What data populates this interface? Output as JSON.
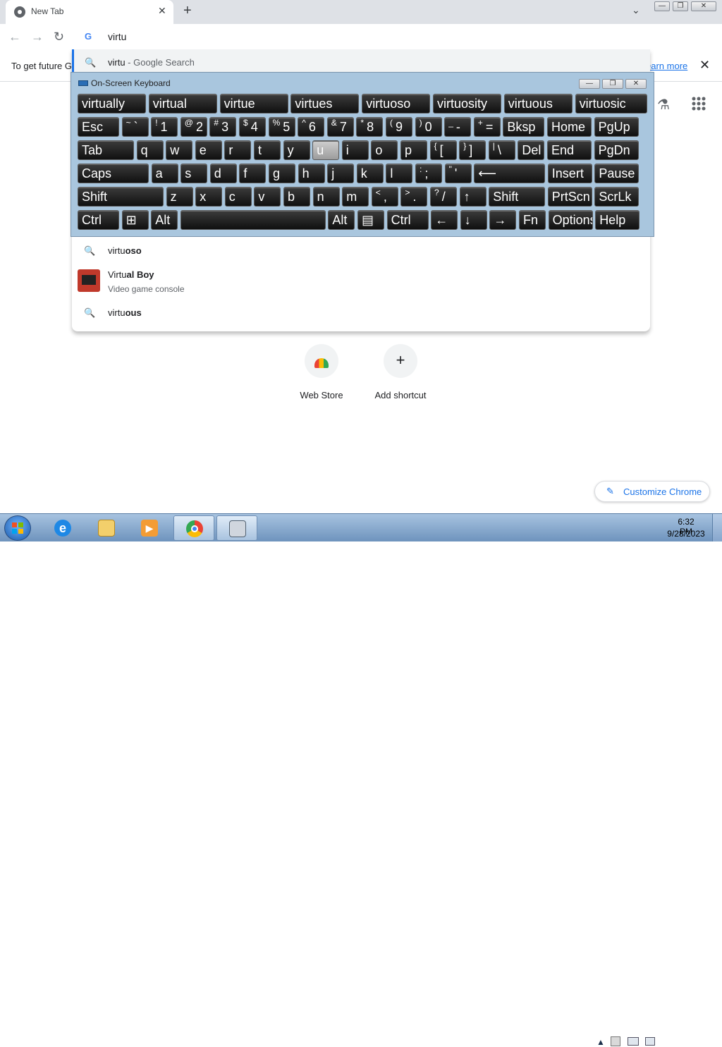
{
  "browser": {
    "tab_title": "New Tab",
    "tab_close": "✕",
    "new_tab": "+",
    "tab_search": "⌄",
    "window_min": "—",
    "window_restore": "❐",
    "window_close": "✕",
    "nav_back": "←",
    "nav_forward": "→",
    "nav_reload": "↻",
    "omnibox_value": "virtu",
    "omnibox_icon": "G",
    "info_text": "To get future G",
    "info_link": "earn more",
    "info_close": "✕",
    "kebab": "⋮"
  },
  "dropdown": {
    "first": {
      "query": "virtu",
      "suffix": " - Google Search"
    },
    "items": [
      {
        "prefix": "virtu",
        "bold": "oso",
        "sub": ""
      },
      {
        "prefix": "Virtu",
        "bold": "al Boy",
        "sub": "Video game console"
      },
      {
        "prefix": "virtu",
        "bold": "ous",
        "sub": ""
      }
    ],
    "search_icon": "🔍"
  },
  "osk": {
    "title": "On-Screen Keyboard",
    "title_min": "—",
    "title_restore": "❐",
    "title_close": "✕",
    "predictions": [
      "virtually",
      "virtual",
      "virtue",
      "virtues",
      "virtuoso",
      "virtuosity",
      "virtuous",
      "virtuosic"
    ],
    "row1": [
      {
        "label": "Esc"
      },
      {
        "sup": "~",
        "main": "`"
      },
      {
        "sup": "!",
        "main": "1"
      },
      {
        "sup": "@",
        "main": "2"
      },
      {
        "sup": "#",
        "main": "3"
      },
      {
        "sup": "$",
        "main": "4"
      },
      {
        "sup": "%",
        "main": "5"
      },
      {
        "sup": "^",
        "main": "6"
      },
      {
        "sup": "&",
        "main": "7"
      },
      {
        "sup": "*",
        "main": "8"
      },
      {
        "sup": "(",
        "main": "9"
      },
      {
        "sup": ")",
        "main": "0"
      },
      {
        "sup": "_",
        "main": "-"
      },
      {
        "sup": "+",
        "main": "="
      },
      {
        "label": "Bksp"
      },
      {
        "label": "Home"
      },
      {
        "label": "PgUp"
      }
    ],
    "row2": [
      {
        "label": "Tab"
      },
      {
        "label": "q"
      },
      {
        "label": "w"
      },
      {
        "label": "e"
      },
      {
        "label": "r"
      },
      {
        "label": "t"
      },
      {
        "label": "y"
      },
      {
        "label": "u"
      },
      {
        "label": "i"
      },
      {
        "label": "o"
      },
      {
        "label": "p"
      },
      {
        "sup": "{",
        "main": "["
      },
      {
        "sup": "}",
        "main": "]"
      },
      {
        "sup": "|",
        "main": "\\"
      },
      {
        "label": "Del"
      },
      {
        "label": "End"
      },
      {
        "label": "PgDn"
      }
    ],
    "row3": [
      {
        "label": "Caps"
      },
      {
        "label": "a"
      },
      {
        "label": "s"
      },
      {
        "label": "d"
      },
      {
        "label": "f"
      },
      {
        "label": "g"
      },
      {
        "label": "h"
      },
      {
        "label": "j"
      },
      {
        "label": "k"
      },
      {
        "label": "l"
      },
      {
        "sup": ":",
        "main": ";"
      },
      {
        "sup": "\"",
        "main": "'"
      },
      {
        "label": "⟵"
      },
      {
        "label": "Insert"
      },
      {
        "label": "Pause"
      }
    ],
    "row4": [
      {
        "label": "Shift"
      },
      {
        "label": "z"
      },
      {
        "label": "x"
      },
      {
        "label": "c"
      },
      {
        "label": "v"
      },
      {
        "label": "b"
      },
      {
        "label": "n"
      },
      {
        "label": "m"
      },
      {
        "sup": "<",
        "main": ","
      },
      {
        "sup": ">",
        "main": "."
      },
      {
        "sup": "?",
        "main": "/"
      },
      {
        "label": "↑"
      },
      {
        "label": "Shift"
      },
      {
        "label": "PrtScn"
      },
      {
        "label": "ScrLk"
      }
    ],
    "row5": [
      {
        "label": "Ctrl"
      },
      {
        "label": "⊞"
      },
      {
        "label": "Alt"
      },
      {
        "label": ""
      },
      {
        "label": "Alt"
      },
      {
        "label": "▤"
      },
      {
        "label": "Ctrl"
      },
      {
        "label": "←"
      },
      {
        "label": "↓"
      },
      {
        "label": "→"
      },
      {
        "label": "Fn"
      },
      {
        "label": "Options"
      },
      {
        "label": "Help"
      }
    ],
    "highlighted_key": "u"
  },
  "ntp": {
    "shortcuts": [
      {
        "label": "Web Store"
      },
      {
        "label": "Add shortcut",
        "icon": "+"
      }
    ],
    "labs_icon": "⚗",
    "apps_icon": "⋮⋮⋮",
    "customize_label": "Customize Chrome",
    "customize_icon": "✎"
  },
  "taskbar": {
    "time": "6:32 PM",
    "date": "9/28/2023",
    "tray_arrow": "▲",
    "items": [
      "internet-explorer",
      "file-explorer",
      "media-player",
      "chrome",
      "on-screen-keyboard"
    ]
  }
}
